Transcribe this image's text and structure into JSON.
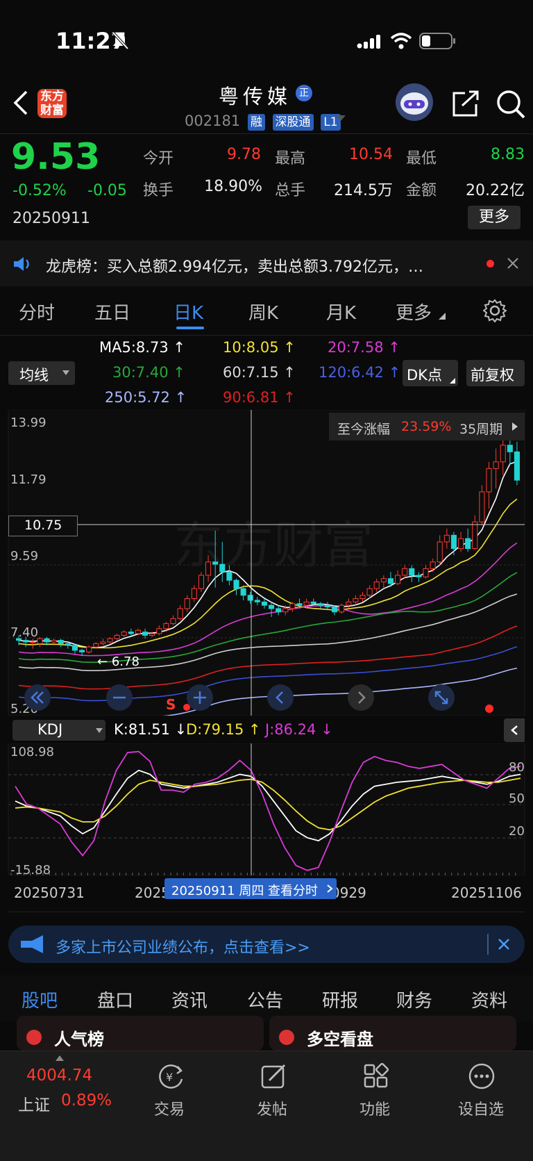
{
  "status": {
    "time": "11:27"
  },
  "nav": {
    "logo_line1": "东方",
    "logo_line2": "财富",
    "stock_name": "粤传媒",
    "name_badge": "正",
    "code": "002181",
    "badges": [
      "融",
      "深股通",
      "L1"
    ]
  },
  "quote": {
    "price": "9.53",
    "change_pct": "-0.52%",
    "change": "-0.05",
    "date": "20250911",
    "open_label": "今开",
    "open": "9.78",
    "high_label": "最高",
    "high": "10.54",
    "low_label": "最低",
    "low": "8.83",
    "turnover_label": "换手",
    "turnover": "18.90%",
    "volume_label": "总手",
    "volume": "214.5万",
    "amount_label": "金额",
    "amount": "20.22亿",
    "more": "更多"
  },
  "notice": {
    "text": "龙虎榜：买入总额2.994亿元，卖出总额3.792亿元，…"
  },
  "tabs": [
    "分时",
    "五日",
    "日K",
    "周K",
    "月K",
    "更多"
  ],
  "ma": {
    "selector": "均线",
    "ma5": "MA5:8.73",
    "ma10": "10:8.05",
    "ma20": "20:7.58",
    "ma30": "30:7.40",
    "ma60": "60:7.15",
    "ma120": "120:6.42",
    "ma250": "250:5.72",
    "ma90": "90:6.81",
    "dk_button": "DK点",
    "adjust_button": "前复权"
  },
  "chart": {
    "y_top": "13.99",
    "y_mid1": "11.79",
    "y_cross": "10.75",
    "y_mid2": "9.59",
    "y_mid3": "7.40",
    "y_bottom": "5.20",
    "low_marker": "6.78",
    "gain_label": "至今涨幅",
    "gain_value": "23.59%",
    "gain_period": "35周期",
    "watermark": "东方财富",
    "sell_marker": "S"
  },
  "chart_data": {
    "type": "candlestick",
    "ylim": [
      5.2,
      13.99
    ],
    "candles": [
      {
        "o": 7.3,
        "c": 7.25,
        "h": 7.4,
        "l": 7.1
      },
      {
        "o": 7.25,
        "c": 7.2,
        "h": 7.35,
        "l": 7.05
      },
      {
        "o": 7.2,
        "c": 7.2,
        "h": 7.3,
        "l": 7.0
      },
      {
        "o": 7.15,
        "c": 7.3,
        "h": 7.35,
        "l": 7.05
      },
      {
        "o": 7.3,
        "c": 7.2,
        "h": 7.35,
        "l": 7.1
      },
      {
        "o": 7.2,
        "c": 7.25,
        "h": 7.3,
        "l": 7.1
      },
      {
        "o": 7.25,
        "c": 7.15,
        "h": 7.3,
        "l": 7.05
      },
      {
        "o": 7.15,
        "c": 7.1,
        "h": 7.2,
        "l": 7.0
      },
      {
        "o": 7.1,
        "c": 6.95,
        "h": 7.15,
        "l": 6.85
      },
      {
        "o": 6.95,
        "c": 6.9,
        "h": 7.0,
        "l": 6.78
      },
      {
        "o": 6.9,
        "c": 7.05,
        "h": 7.1,
        "l": 6.85
      },
      {
        "o": 7.05,
        "c": 7.15,
        "h": 7.2,
        "l": 7.0
      },
      {
        "o": 7.15,
        "c": 7.2,
        "h": 7.3,
        "l": 7.1
      },
      {
        "o": 7.2,
        "c": 7.3,
        "h": 7.35,
        "l": 7.15
      },
      {
        "o": 7.3,
        "c": 7.4,
        "h": 7.45,
        "l": 7.25
      },
      {
        "o": 7.4,
        "c": 7.5,
        "h": 7.55,
        "l": 7.35
      },
      {
        "o": 7.5,
        "c": 7.45,
        "h": 7.6,
        "l": 7.4
      },
      {
        "o": 7.45,
        "c": 7.55,
        "h": 7.6,
        "l": 7.4
      },
      {
        "o": 7.5,
        "c": 7.4,
        "h": 7.6,
        "l": 7.3
      },
      {
        "o": 7.4,
        "c": 7.45,
        "h": 7.5,
        "l": 7.35
      },
      {
        "o": 7.45,
        "c": 7.6,
        "h": 7.7,
        "l": 7.4
      },
      {
        "o": 7.6,
        "c": 7.75,
        "h": 7.8,
        "l": 7.5
      },
      {
        "o": 7.75,
        "c": 7.9,
        "h": 8.0,
        "l": 7.7
      },
      {
        "o": 7.9,
        "c": 8.2,
        "h": 8.3,
        "l": 7.85
      },
      {
        "o": 8.2,
        "c": 8.5,
        "h": 8.6,
        "l": 8.1
      },
      {
        "o": 8.5,
        "c": 8.8,
        "h": 8.9,
        "l": 8.4
      },
      {
        "o": 8.8,
        "c": 9.2,
        "h": 9.3,
        "l": 8.7
      },
      {
        "o": 9.2,
        "c": 9.6,
        "h": 9.8,
        "l": 9.0
      },
      {
        "o": 9.6,
        "c": 9.53,
        "h": 10.54,
        "l": 8.83
      },
      {
        "o": 9.53,
        "c": 9.3,
        "h": 10.2,
        "l": 9.0
      },
      {
        "o": 9.3,
        "c": 9.05,
        "h": 9.5,
        "l": 8.9
      },
      {
        "o": 9.05,
        "c": 8.8,
        "h": 9.1,
        "l": 8.6
      },
      {
        "o": 8.8,
        "c": 8.6,
        "h": 8.9,
        "l": 8.45
      },
      {
        "o": 8.6,
        "c": 8.45,
        "h": 8.7,
        "l": 8.35
      },
      {
        "o": 8.45,
        "c": 8.4,
        "h": 8.55,
        "l": 8.3
      },
      {
        "o": 8.4,
        "c": 8.3,
        "h": 8.5,
        "l": 8.2
      },
      {
        "o": 8.3,
        "c": 8.2,
        "h": 8.4,
        "l": 7.95
      },
      {
        "o": 8.2,
        "c": 8.1,
        "h": 8.3,
        "l": 8.0
      },
      {
        "o": 8.1,
        "c": 8.2,
        "h": 8.3,
        "l": 8.0
      },
      {
        "o": 8.2,
        "c": 8.35,
        "h": 8.4,
        "l": 8.1
      },
      {
        "o": 8.35,
        "c": 8.3,
        "h": 8.5,
        "l": 8.2
      },
      {
        "o": 8.3,
        "c": 8.4,
        "h": 8.5,
        "l": 8.2
      },
      {
        "o": 8.4,
        "c": 8.35,
        "h": 8.5,
        "l": 8.3
      },
      {
        "o": 8.35,
        "c": 8.3,
        "h": 8.4,
        "l": 8.2
      },
      {
        "o": 8.3,
        "c": 8.25,
        "h": 8.4,
        "l": 8.15
      },
      {
        "o": 8.25,
        "c": 8.1,
        "h": 8.3,
        "l": 8.0
      },
      {
        "o": 8.1,
        "c": 8.3,
        "h": 8.35,
        "l": 8.05
      },
      {
        "o": 8.3,
        "c": 8.4,
        "h": 8.5,
        "l": 8.2
      },
      {
        "o": 8.4,
        "c": 8.5,
        "h": 8.6,
        "l": 8.3
      },
      {
        "o": 8.5,
        "c": 8.6,
        "h": 8.7,
        "l": 8.4
      },
      {
        "o": 8.6,
        "c": 8.8,
        "h": 8.9,
        "l": 8.5
      },
      {
        "o": 8.8,
        "c": 9.0,
        "h": 9.1,
        "l": 8.7
      },
      {
        "o": 9.0,
        "c": 9.1,
        "h": 9.2,
        "l": 8.8
      },
      {
        "o": 9.1,
        "c": 8.95,
        "h": 9.3,
        "l": 8.85
      },
      {
        "o": 8.95,
        "c": 9.2,
        "h": 9.35,
        "l": 8.9
      },
      {
        "o": 9.2,
        "c": 9.4,
        "h": 9.5,
        "l": 9.1
      },
      {
        "o": 9.4,
        "c": 9.2,
        "h": 9.5,
        "l": 9.0
      },
      {
        "o": 9.2,
        "c": 9.15,
        "h": 9.3,
        "l": 9.0
      },
      {
        "o": 9.15,
        "c": 9.4,
        "h": 9.5,
        "l": 9.1
      },
      {
        "o": 9.4,
        "c": 9.6,
        "h": 9.7,
        "l": 9.3
      },
      {
        "o": 9.6,
        "c": 10.2,
        "h": 10.4,
        "l": 9.5
      },
      {
        "o": 10.2,
        "c": 10.4,
        "h": 10.6,
        "l": 10.0
      },
      {
        "o": 10.4,
        "c": 10.0,
        "h": 10.5,
        "l": 9.8
      },
      {
        "o": 10.0,
        "c": 10.3,
        "h": 10.5,
        "l": 9.9
      },
      {
        "o": 10.3,
        "c": 10.0,
        "h": 10.6,
        "l": 9.9
      },
      {
        "o": 10.0,
        "c": 10.8,
        "h": 11.0,
        "l": 9.95
      },
      {
        "o": 10.8,
        "c": 11.7,
        "h": 11.9,
        "l": 10.7
      },
      {
        "o": 11.7,
        "c": 12.4,
        "h": 12.6,
        "l": 11.2
      },
      {
        "o": 12.4,
        "c": 12.6,
        "h": 13.0,
        "l": 11.8
      },
      {
        "o": 12.6,
        "c": 13.1,
        "h": 13.4,
        "l": 12.2
      },
      {
        "o": 13.1,
        "c": 12.9,
        "h": 13.6,
        "l": 12.5
      },
      {
        "o": 12.9,
        "c": 12.05,
        "h": 13.2,
        "l": 11.9
      }
    ],
    "kdj": {
      "ylim": [
        -15.88,
        108.98
      ],
      "levels": [
        80,
        50,
        20
      ],
      "K": [
        55,
        50,
        48,
        44,
        40,
        30,
        22,
        28,
        45,
        62,
        78,
        86,
        82,
        72,
        70,
        68,
        70,
        72,
        74,
        78,
        82,
        80,
        70,
        55,
        40,
        25,
        18,
        15,
        22,
        35,
        50,
        62,
        70,
        72,
        74,
        75,
        76,
        78,
        80,
        78,
        76,
        74,
        72,
        75,
        80,
        82
      ],
      "D": [
        48,
        49,
        48,
        46,
        44,
        38,
        34,
        34,
        40,
        50,
        62,
        72,
        76,
        74,
        72,
        70,
        70,
        71,
        72,
        74,
        76,
        77,
        74,
        66,
        56,
        45,
        35,
        28,
        26,
        30,
        38,
        46,
        54,
        60,
        64,
        68,
        70,
        72,
        74,
        75,
        76,
        75,
        74,
        74,
        76,
        78
      ],
      "J": [
        70,
        52,
        48,
        40,
        32,
        14,
        0,
        15,
        55,
        86,
        104,
        105,
        95,
        66,
        66,
        64,
        72,
        74,
        78,
        86,
        96,
        86,
        62,
        32,
        8,
        -10,
        -15,
        -12,
        14,
        45,
        74,
        94,
        100,
        96,
        94,
        90,
        88,
        90,
        92,
        84,
        76,
        72,
        68,
        78,
        88,
        90
      ]
    },
    "x_ticks": [
      "20250731",
      "20250829",
      "20250929",
      "20251106"
    ]
  },
  "kdj": {
    "selector": "KDJ",
    "k": "K:81.51",
    "d": "D:79.15",
    "j": "J:86.24",
    "y_top": "108.98",
    "y_bottom": "-15.88",
    "l80": "80",
    "l50": "50",
    "l20": "20"
  },
  "xaxis": {
    "d1": "20250731",
    "d2": "20250829",
    "d3": "20250929",
    "d4": "20251106",
    "cross_label": "20250911 周四 查看分时"
  },
  "banner": {
    "text": "多家上市公司业绩公布，点击查看>>"
  },
  "bottom_tabs": [
    "股吧",
    "盘口",
    "资讯",
    "公告",
    "研报",
    "财务",
    "资料"
  ],
  "peek": {
    "left": "人气榜",
    "right": "多空看盘"
  },
  "bottom_nav": {
    "index_value": "4004.74",
    "index_name": "上证",
    "index_change": "0.89%",
    "trade": "交易",
    "post": "发帖",
    "functions": "功能",
    "watchlist": "设自选"
  },
  "colors": {
    "up": "#ff3b30",
    "down": "#1fd24a",
    "accent": "#3b8bf0",
    "ma5": "#ffffff",
    "ma10": "#f2e232",
    "ma20": "#d93bd6",
    "ma30": "#27a83a",
    "ma60": "#d0d0d0",
    "ma120": "#3a4fd6",
    "ma250": "#a9b7ff",
    "ma90": "#e02020"
  }
}
